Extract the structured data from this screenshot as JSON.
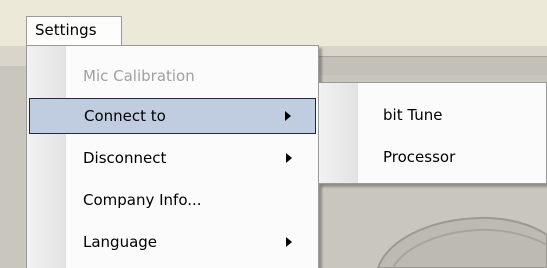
{
  "menubar": {
    "settings_label": "Settings"
  },
  "settings_menu": {
    "items": [
      {
        "label": "Mic Calibration",
        "disabled": true,
        "submenu": false
      },
      {
        "label": "Connect to",
        "disabled": false,
        "submenu": true,
        "highlighted": true
      },
      {
        "label": "Disconnect",
        "disabled": false,
        "submenu": true
      },
      {
        "label": "Company Info...",
        "disabled": false,
        "submenu": false
      },
      {
        "label": "Language",
        "disabled": false,
        "submenu": true
      }
    ]
  },
  "connect_submenu": {
    "items": [
      {
        "label": "bit Tune"
      },
      {
        "label": "Processor"
      }
    ]
  },
  "colors": {
    "highlight_fill": "#c0cde0",
    "highlight_border": "#1e2a46",
    "disabled_text": "#a0a0a0",
    "menu_bg": "#fbfbfb",
    "window_bg": "#ece9d8"
  },
  "icons": [
    "submenu-arrow-icon"
  ]
}
